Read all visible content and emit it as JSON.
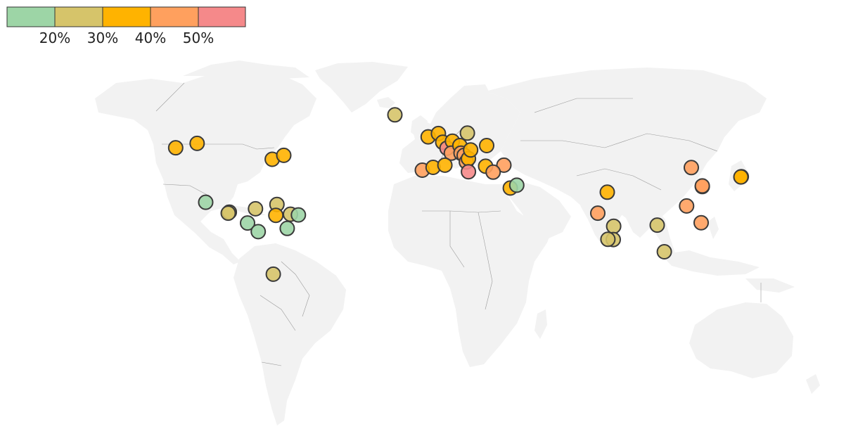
{
  "legend": {
    "colors": [
      "#9dd5a6",
      "#d6c46a",
      "#ffb300",
      "#ffa05e",
      "#f5898a"
    ],
    "labels": [
      "20%",
      "30%",
      "40%",
      "50%"
    ]
  },
  "map": {
    "land_color": "#f2f2f2",
    "border_color": "#9a9a9a"
  },
  "points": [
    {
      "lon": -124,
      "lat": 49,
      "level": 2
    },
    {
      "lon": -114,
      "lat": 51,
      "level": 2
    },
    {
      "lon": -79,
      "lat": 43.7,
      "level": 2
    },
    {
      "lon": -73.6,
      "lat": 45.5,
      "level": 2
    },
    {
      "lon": -110,
      "lat": 24,
      "level": 0
    },
    {
      "lon": -99,
      "lat": 19.5,
      "level": 1
    },
    {
      "lon": -99.5,
      "lat": 19,
      "level": 1
    },
    {
      "lon": -86.8,
      "lat": 21,
      "level": 1
    },
    {
      "lon": -76.8,
      "lat": 23,
      "level": 1
    },
    {
      "lon": -77.3,
      "lat": 18,
      "level": 2
    },
    {
      "lon": -70.5,
      "lat": 18.5,
      "level": 1
    },
    {
      "lon": -66.8,
      "lat": 18.2,
      "level": 0
    },
    {
      "lon": -90.5,
      "lat": 14.5,
      "level": 0
    },
    {
      "lon": -85.5,
      "lat": 10.5,
      "level": 0
    },
    {
      "lon": -72,
      "lat": 12,
      "level": 0
    },
    {
      "lon": -78.5,
      "lat": -9,
      "level": 1
    },
    {
      "lon": -21.8,
      "lat": 64.1,
      "level": 1
    },
    {
      "lon": -6.3,
      "lat": 54,
      "level": 2
    },
    {
      "lon": -1.5,
      "lat": 55.5,
      "level": 2
    },
    {
      "lon": 0.5,
      "lat": 51.5,
      "level": 2
    },
    {
      "lon": 2.5,
      "lat": 48.8,
      "level": 4
    },
    {
      "lon": 5,
      "lat": 52,
      "level": 2
    },
    {
      "lon": 4.5,
      "lat": 46.5,
      "level": 3
    },
    {
      "lon": 8.5,
      "lat": 50,
      "level": 2
    },
    {
      "lon": 9,
      "lat": 46.5,
      "level": 3
    },
    {
      "lon": 10.5,
      "lat": 45.5,
      "level": 3
    },
    {
      "lon": 11.5,
      "lat": 42.5,
      "level": 3
    },
    {
      "lon": 12.5,
      "lat": 44,
      "level": 2
    },
    {
      "lon": 13.5,
      "lat": 48,
      "level": 2
    },
    {
      "lon": 12,
      "lat": 55.7,
      "level": 1
    },
    {
      "lon": 21,
      "lat": 50,
      "level": 2
    },
    {
      "lon": -9,
      "lat": 38.7,
      "level": 3
    },
    {
      "lon": -4,
      "lat": 40,
      "level": 2
    },
    {
      "lon": 1.5,
      "lat": 41,
      "level": 2
    },
    {
      "lon": 12.5,
      "lat": 38,
      "level": 4
    },
    {
      "lon": 20.5,
      "lat": 40.5,
      "level": 2
    },
    {
      "lon": 29,
      "lat": 41,
      "level": 3
    },
    {
      "lon": 24,
      "lat": 37.8,
      "level": 3
    },
    {
      "lon": 32,
      "lat": 30.5,
      "level": 2
    },
    {
      "lon": 35,
      "lat": 31.8,
      "level": 0
    },
    {
      "lon": 72.8,
      "lat": 19,
      "level": 3
    },
    {
      "lon": 77.2,
      "lat": 28.6,
      "level": 2
    },
    {
      "lon": 80.2,
      "lat": 13,
      "level": 1
    },
    {
      "lon": 80,
      "lat": 6.9,
      "level": 1
    },
    {
      "lon": 77.5,
      "lat": 7,
      "level": 1
    },
    {
      "lon": 100.5,
      "lat": 13.5,
      "level": 1
    },
    {
      "lon": 103.8,
      "lat": 1.3,
      "level": 1
    },
    {
      "lon": 114.2,
      "lat": 22.3,
      "level": 3
    },
    {
      "lon": 121,
      "lat": 14.6,
      "level": 3
    },
    {
      "lon": 121.5,
      "lat": 31.2,
      "level": 3
    },
    {
      "lon": 121.5,
      "lat": 31.5,
      "level": 3
    },
    {
      "lon": 116.4,
      "lat": 39.9,
      "level": 3
    },
    {
      "lon": 139.7,
      "lat": 35.7,
      "level": 2
    },
    {
      "lon": 139.5,
      "lat": 35.6,
      "level": 2
    }
  ]
}
